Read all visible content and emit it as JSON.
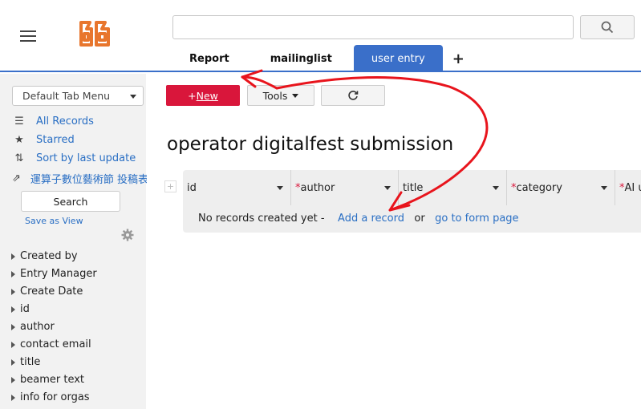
{
  "header": {
    "logo_name": "app-logo",
    "search_placeholder": "",
    "tabs": [
      {
        "label": "Report",
        "active": false
      },
      {
        "label": "mailinglist",
        "active": false
      },
      {
        "label": "user entry",
        "active": true
      }
    ],
    "add_tab_label": "+"
  },
  "sidebar": {
    "tab_menu": "Default Tab Menu",
    "nav": [
      {
        "label": "All Records",
        "icon": "list-icon"
      },
      {
        "label": "Starred",
        "icon": "star-icon"
      },
      {
        "label": "Sort by last update",
        "icon": "sort-icon"
      },
      {
        "label": "運算子數位藝術節 投稿表",
        "icon": "share-icon"
      }
    ],
    "search_label": "Search",
    "save_view_label": "Save as View",
    "fields": [
      "Created by",
      "Entry Manager",
      "Create Date",
      "id",
      "author",
      "contact email",
      "title",
      "beamer text",
      "info for orgas"
    ]
  },
  "toolbar": {
    "new_prefix": "+",
    "new_label": "New",
    "tools_label": "Tools",
    "refresh_icon": "refresh-icon"
  },
  "main": {
    "title": "operator digitalfest submission",
    "columns": [
      {
        "label": "id",
        "required": false
      },
      {
        "label": "author",
        "required": true
      },
      {
        "label": "title",
        "required": false
      },
      {
        "label": "category",
        "required": true
      },
      {
        "label": "AI u",
        "required": true
      }
    ],
    "no_records_text": "No records created yet -",
    "add_record_link": "Add a record",
    "or_text": "or",
    "form_page_link": "go to form page"
  },
  "colors": {
    "accent": "#3a6fc9",
    "new_button": "#d9163b",
    "link": "#2a6fc4",
    "logo": "#e8762d",
    "annotation_arrow": "#e8141c"
  }
}
